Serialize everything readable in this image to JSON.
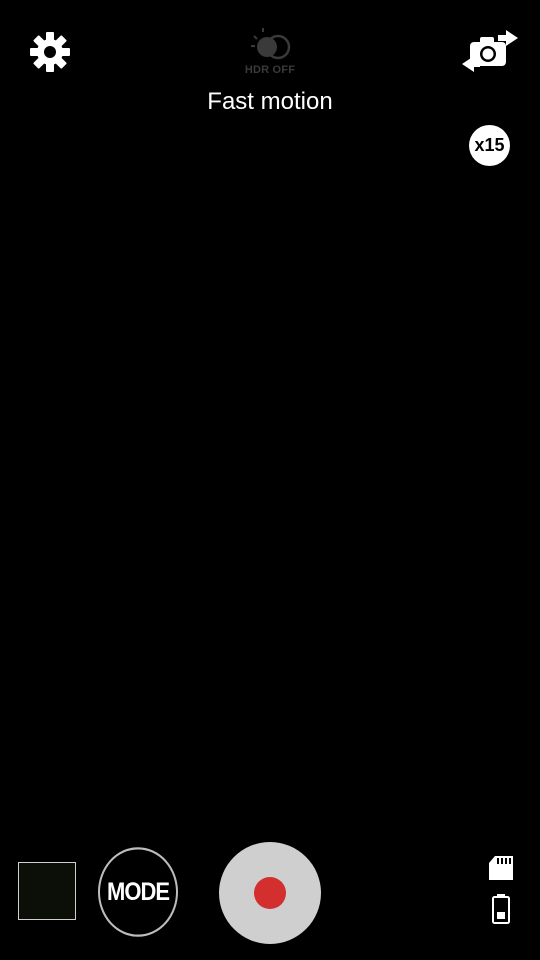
{
  "top_bar": {
    "settings_icon": "gear-icon",
    "hdr_icon": "hdr-icon",
    "hdr_label": "HDR OFF",
    "switch_camera_icon": "switch-camera-icon"
  },
  "mode_title": "Fast motion",
  "speed_badge": "x15",
  "bottom_bar": {
    "mode_label": "MODE",
    "record_icon": "record-icon",
    "storage_icon": "sd-card-icon",
    "battery_icon": "battery-icon"
  },
  "colors": {
    "background": "#000000",
    "record_dot": "#d32f2f",
    "record_ring": "#cfcfcf",
    "hdr_disabled": "#3a3a3a"
  }
}
